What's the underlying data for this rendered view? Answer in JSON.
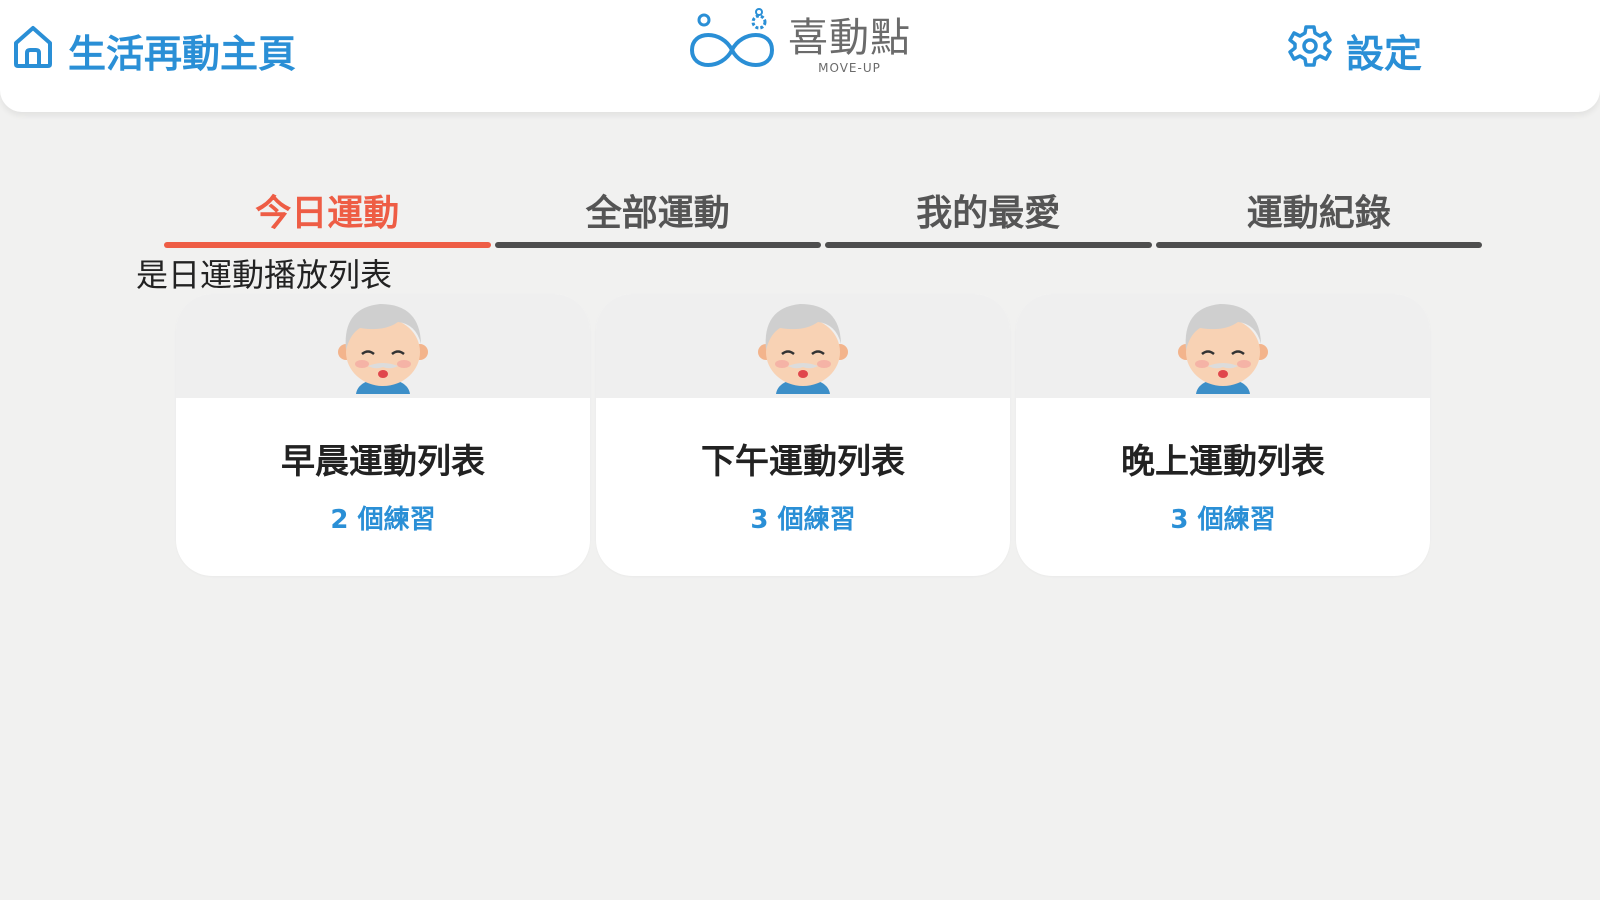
{
  "header": {
    "home_label": "生活再動主頁",
    "logo_name": "喜動點",
    "logo_sub": "MOVE-UP",
    "settings_label": "設定"
  },
  "tabs": [
    {
      "label": "今日運動",
      "active": true
    },
    {
      "label": "全部運動",
      "active": false
    },
    {
      "label": "我的最愛",
      "active": false
    },
    {
      "label": "運動紀錄",
      "active": false
    }
  ],
  "section_title": "是日運動播放列表",
  "cards": [
    {
      "title": "早晨運動列表",
      "count": "2 個練習",
      "icon": "elderly-avatar-icon"
    },
    {
      "title": "下午運動列表",
      "count": "3 個練習",
      "icon": "elderly-avatar-icon"
    },
    {
      "title": "晚上運動列表",
      "count": "3 個練習",
      "icon": "elderly-avatar-icon"
    }
  ],
  "colors": {
    "accent_blue": "#2a8fd6",
    "active_tab": "#ee5d45",
    "background": "#f1f1f0"
  }
}
